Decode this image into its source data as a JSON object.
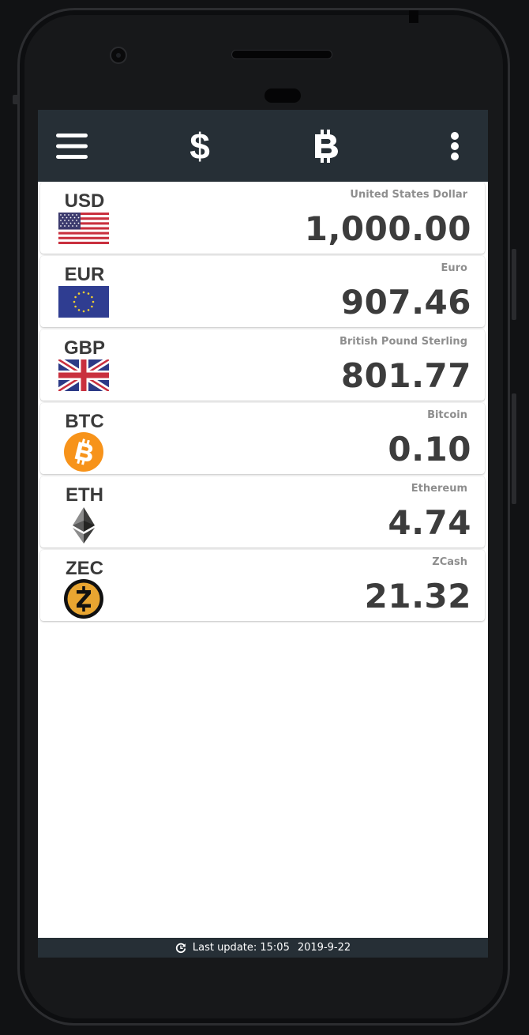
{
  "toolbar": {
    "menu_icon": "hamburger-menu-icon",
    "fiat_icon": "dollar-sign-icon",
    "crypto_icon": "bitcoin-sign-icon",
    "more_icon": "more-vert-icon"
  },
  "currencies": [
    {
      "code": "USD",
      "name": "United States Dollar",
      "amount": "1,000.00",
      "icon": "us-flag-icon"
    },
    {
      "code": "EUR",
      "name": "Euro",
      "amount": "907.46",
      "icon": "eu-flag-icon"
    },
    {
      "code": "GBP",
      "name": "British Pound Sterling",
      "amount": "801.77",
      "icon": "uk-flag-icon"
    },
    {
      "code": "BTC",
      "name": "Bitcoin",
      "amount": "0.10",
      "icon": "bitcoin-icon"
    },
    {
      "code": "ETH",
      "name": "Ethereum",
      "amount": "4.74",
      "icon": "ethereum-icon"
    },
    {
      "code": "ZEC",
      "name": "ZCash",
      "amount": "21.32",
      "icon": "zcash-icon"
    }
  ],
  "footer": {
    "label": "Last update: 15:05",
    "date": "2019-9-22"
  },
  "colors": {
    "toolbar": "#262f36",
    "text_dark": "#3c3c3c",
    "text_muted": "#8e8e8e",
    "bitcoin": "#f7931a",
    "zcash": "#e8a531"
  }
}
